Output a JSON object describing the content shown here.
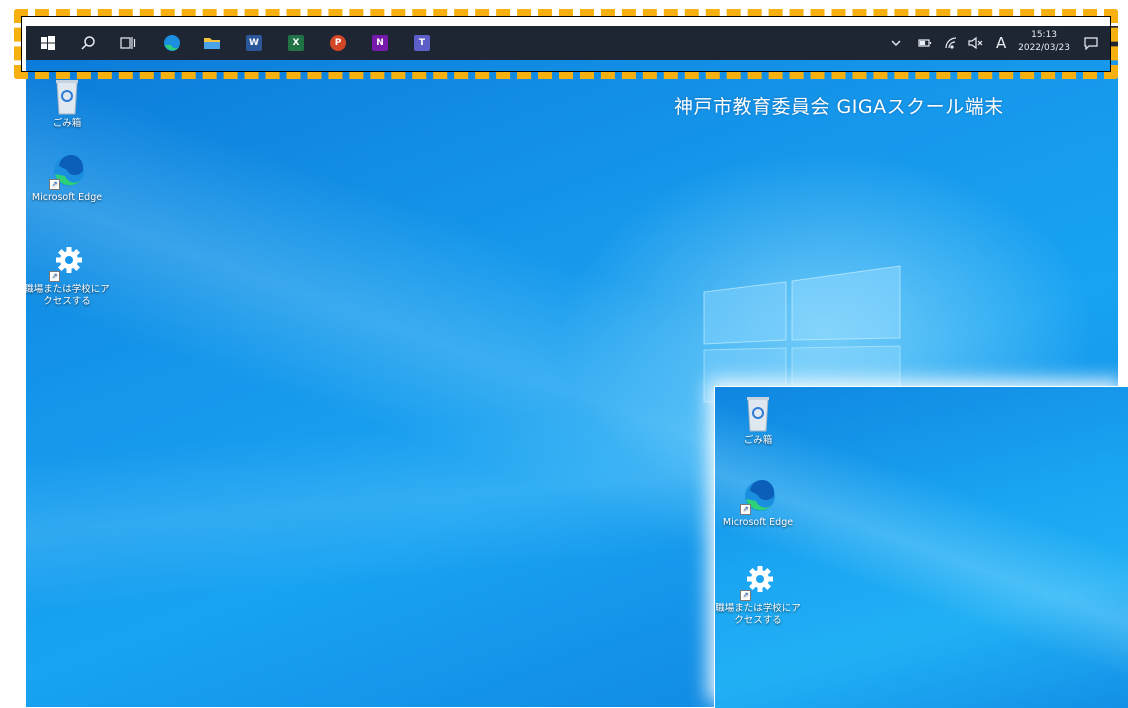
{
  "desktop": {
    "banner_text": "神戸市教育委員会 GIGAスクール端末",
    "icons": [
      {
        "label": "ごみ箱",
        "icon": "recycle-bin-icon"
      },
      {
        "label": "Microsoft Edge",
        "icon": "edge-icon"
      },
      {
        "label": "職場または学校にアクセスする",
        "icon": "settings-gear-icon"
      }
    ]
  },
  "taskbar": {
    "pinned": [
      {
        "name": "start",
        "icon": "windows-start-icon"
      },
      {
        "name": "search",
        "icon": "search-icon"
      },
      {
        "name": "task-view",
        "icon": "task-view-icon"
      },
      {
        "name": "edge",
        "icon": "edge-icon"
      },
      {
        "name": "file-explorer",
        "icon": "folder-icon"
      },
      {
        "name": "word",
        "icon": "word-icon",
        "letter": "W",
        "color": "#2b579a"
      },
      {
        "name": "excel",
        "icon": "excel-icon",
        "letter": "X",
        "color": "#217346"
      },
      {
        "name": "powerpoint",
        "icon": "powerpoint-icon",
        "letter": "P",
        "color": "#d24726"
      },
      {
        "name": "onenote",
        "icon": "onenote-icon",
        "letter": "N",
        "color": "#7719aa"
      },
      {
        "name": "teams",
        "icon": "teams-icon",
        "letter": "T",
        "color": "#5b5fc7"
      }
    ],
    "tray": {
      "ime_label": "A",
      "time": "15:13",
      "date": "2022/03/23"
    }
  },
  "inset": {
    "icons": [
      {
        "label": "ごみ箱"
      },
      {
        "label": "Microsoft Edge"
      },
      {
        "label": "職場または学校にアクセスする"
      }
    ]
  },
  "colors": {
    "highlight": "#f6b110",
    "taskbar": "#1e2633",
    "desktop_blue": "#1596ea"
  }
}
